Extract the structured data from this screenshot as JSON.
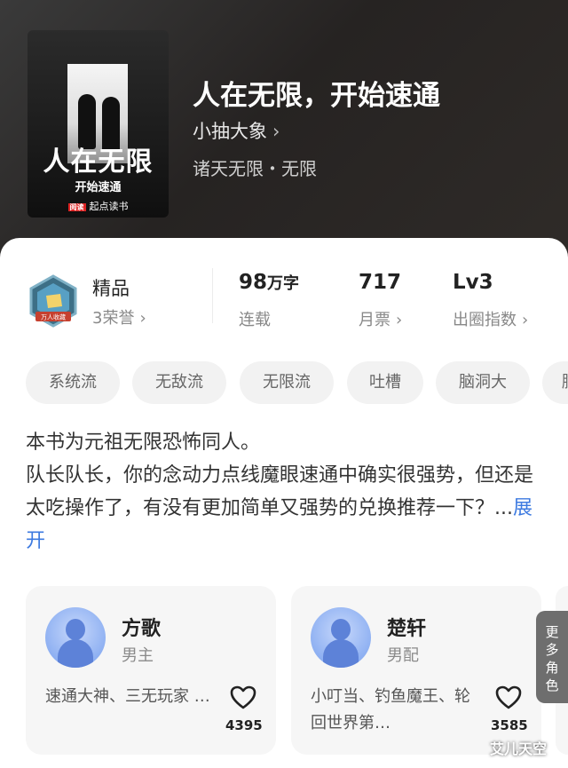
{
  "book": {
    "cover": {
      "title": "人在无限",
      "subtitle": "开始速通",
      "publisher": "起点读书",
      "publisher_badge": "阅读"
    },
    "title": "人在无限，开始速通",
    "author": "小抽大象",
    "author_chevron": "›",
    "genre": "诸天无限・无限"
  },
  "stats": {
    "quality": {
      "label": "精品",
      "honor": "3荣誉",
      "chevron": "›",
      "badge_text": "万人收藏"
    },
    "words": {
      "value": "98",
      "unit": "万字",
      "label": "连载"
    },
    "tickets": {
      "value": "717",
      "label": "月票",
      "chevron": "›"
    },
    "index": {
      "value": "Lv3",
      "label": "出圈指数",
      "chevron": "›"
    }
  },
  "tags": [
    "系统流",
    "无敌流",
    "无限流",
    "吐槽",
    "脑洞大",
    "脑"
  ],
  "description": {
    "text": "本书为元祖无限恐怖同人。\n队长队长，你的念动力点线魔眼速通中确实很强势，但还是太吃操作了，有没有更加简单又强势的兑换推荐一下？...",
    "more": "展开"
  },
  "characters": [
    {
      "name": "方歌",
      "role": "男主",
      "tags": "速通大神、三无玩家 …",
      "likes": "4395"
    },
    {
      "name": "楚轩",
      "role": "男配",
      "tags": "小叮当、钓鱼魔王、轮回世界第…",
      "likes": "3585"
    }
  ],
  "side_tab": "更多角色",
  "watermark": "艾儿天空",
  "colors": {
    "accent": "#3d7ae0",
    "hero_bg": "#2b2826",
    "tag_bg": "#f2f2f2"
  }
}
